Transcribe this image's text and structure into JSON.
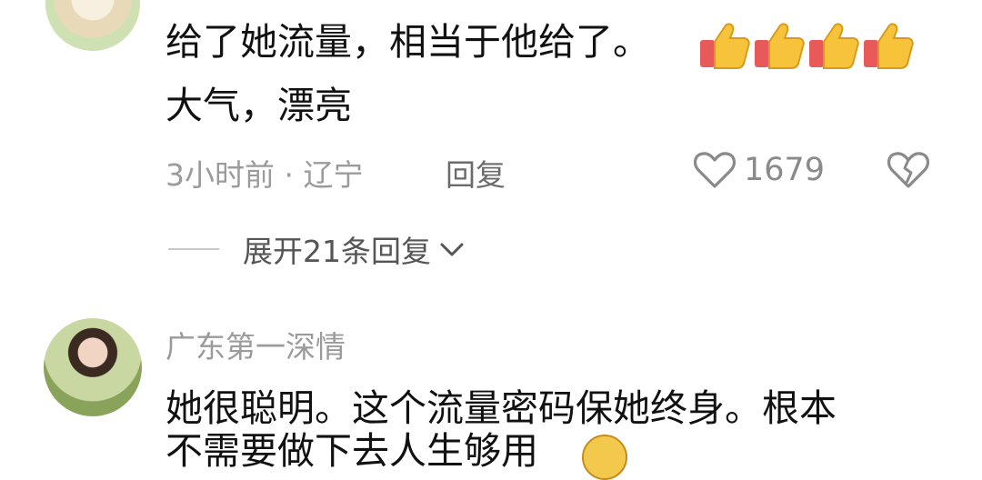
{
  "comment1": {
    "line1": "给了她流量，相当于他给了。",
    "line2": "大气，漂亮",
    "time": "3小时前 · 辽宁",
    "reply_label": "回复",
    "like_count": "1679",
    "thumbs_count": 4
  },
  "replies": {
    "expand_label": "展开21条回复"
  },
  "comment2": {
    "username": "广东第一深情",
    "line1": "她很聪明。这个流量密码保她终身。根本",
    "line2": "不需要做下去人生够用"
  },
  "icons": {
    "like": "heart-outline-icon",
    "dislike": "broken-heart-icon",
    "expand": "chevron-down-icon",
    "thumbs": "thumbs-up-icon"
  }
}
